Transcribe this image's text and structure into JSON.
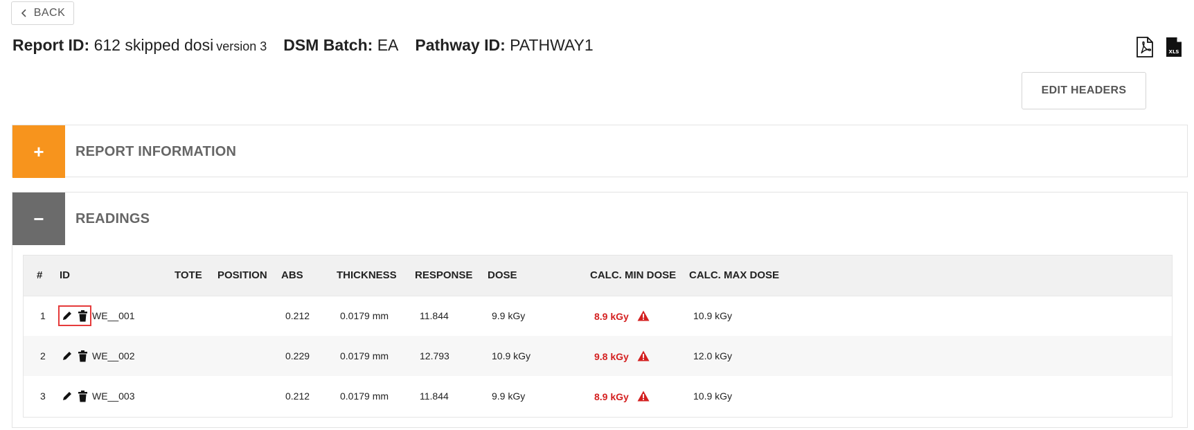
{
  "back": {
    "label": "BACK"
  },
  "header": {
    "report_id_label": "Report ID:",
    "report_id_value": "612 skipped dosi",
    "version": "version 3",
    "dsm_batch_label": "DSM Batch:",
    "dsm_batch_value": "EA",
    "pathway_label": "Pathway ID:",
    "pathway_value": "PATHWAY1"
  },
  "export": {
    "xls_text": "XLS"
  },
  "edit_headers": {
    "label": "EDIT HEADERS"
  },
  "panels": {
    "report_info": {
      "toggle": "+",
      "title": "REPORT INFORMATION",
      "color": "#f7941d"
    },
    "readings": {
      "toggle": "−",
      "title": "READINGS",
      "color": "#6b6b6b"
    }
  },
  "table": {
    "columns": [
      "#",
      "ID",
      "TOTE",
      "POSITION",
      "ABS",
      "THICKNESS",
      "RESPONSE",
      "DOSE",
      "CALC. MIN DOSE",
      "CALC. MAX DOSE"
    ],
    "rows": [
      {
        "num": "1",
        "id": "WE__001",
        "tote": "",
        "position": "",
        "abs": "0.212",
        "thickness": "0.0179 mm",
        "response": "11.844",
        "dose": "9.9 kGy",
        "min_dose": "8.9 kGy",
        "max_dose": "10.9 kGy"
      },
      {
        "num": "2",
        "id": "WE__002",
        "tote": "",
        "position": "",
        "abs": "0.229",
        "thickness": "0.0179 mm",
        "response": "12.793",
        "dose": "10.9 kGy",
        "min_dose": "9.8 kGy",
        "max_dose": "12.0 kGy"
      },
      {
        "num": "3",
        "id": "WE__003",
        "tote": "",
        "position": "",
        "abs": "0.212",
        "thickness": "0.0179 mm",
        "response": "11.844",
        "dose": "9.9 kGy",
        "min_dose": "8.9 kGy",
        "max_dose": "10.9 kGy"
      }
    ]
  },
  "colors": {
    "warning_red": "#d42020",
    "orange": "#f7941d",
    "gray": "#6b6b6b"
  }
}
